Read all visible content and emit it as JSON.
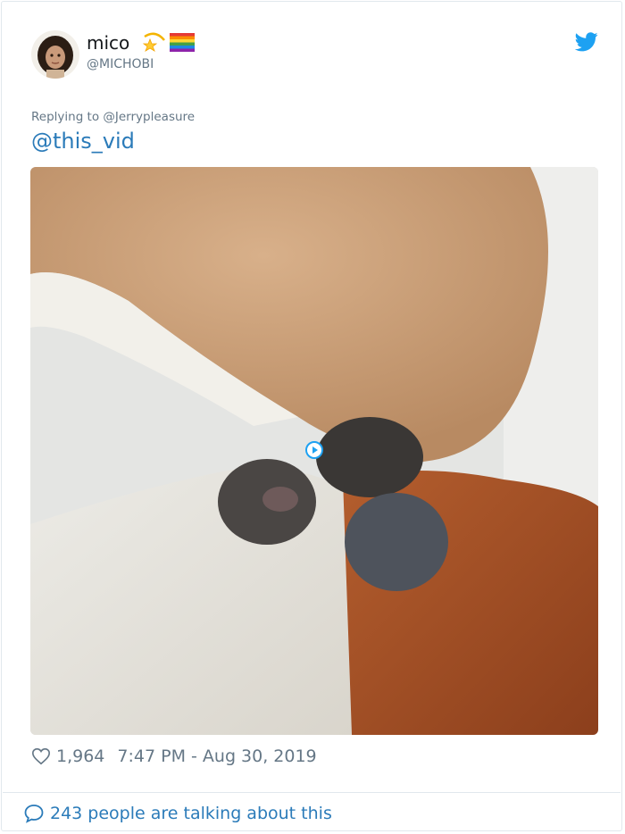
{
  "tweet": {
    "display_name": "mico",
    "handle": "@MICHOBI",
    "name_emojis": [
      "dizzy-star-icon",
      "rainbow-flag-icon"
    ],
    "replying_to": "Replying to @Jerrypleasure",
    "text": "@this_vid",
    "media": {
      "type": "video",
      "play_icon": "play-circle-icon"
    },
    "likes": "1,964",
    "timestamp": "7:47 PM - Aug 30, 2019",
    "talking": "243 people are talking about this"
  },
  "colors": {
    "link": "#2b7bb9",
    "twitter_blue": "#1da1f2",
    "meta_gray": "#657786",
    "text": "#14171a",
    "border": "#e1e8ed"
  }
}
